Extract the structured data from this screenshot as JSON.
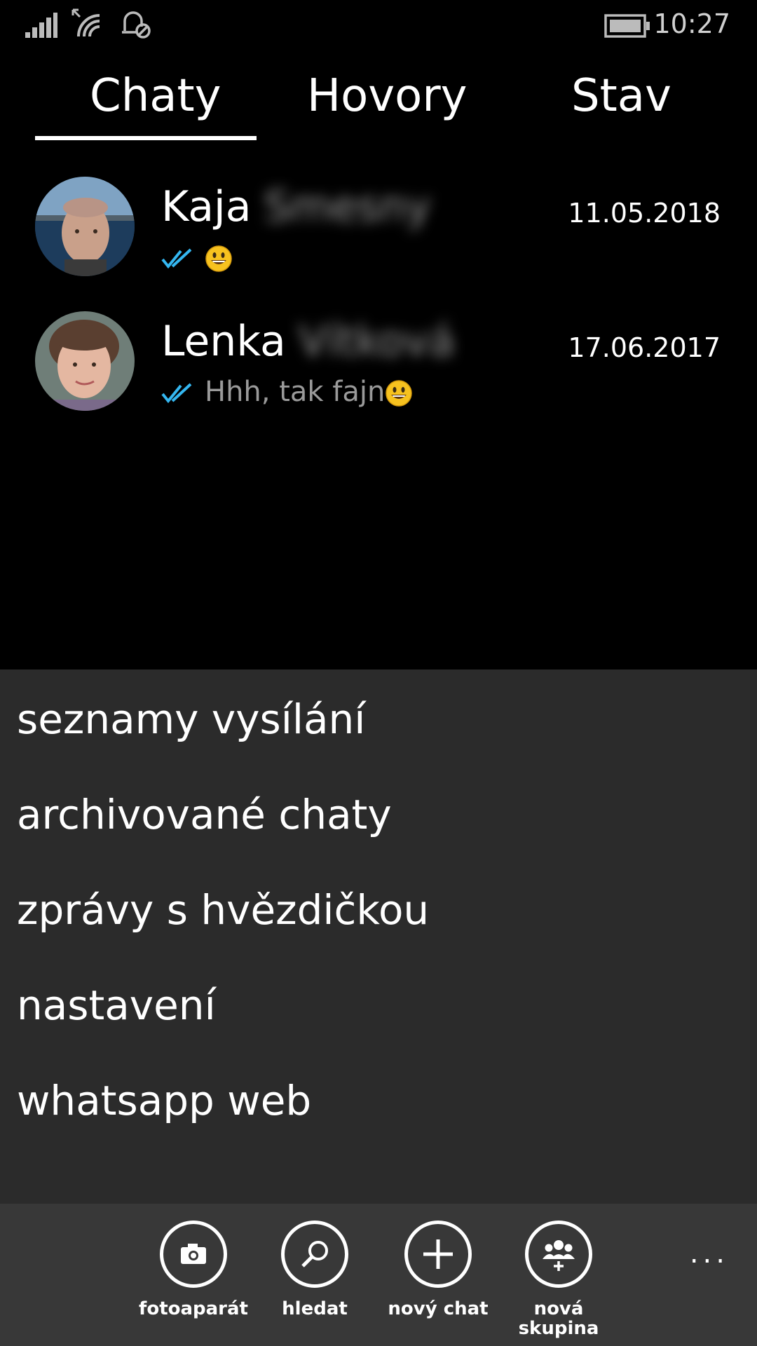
{
  "status_bar": {
    "icons": [
      "signal-icon",
      "wifi-icon",
      "quiet-hours-icon",
      "battery-icon"
    ],
    "time": "10:27"
  },
  "tabs": [
    {
      "label": "Chaty",
      "selected": true
    },
    {
      "label": "Hovory",
      "selected": false
    },
    {
      "label": "Stav",
      "selected": false
    }
  ],
  "chats": [
    {
      "first_name": "Kaja",
      "last_name_blurred": "Smesny",
      "date": "11.05.2018",
      "preview": "",
      "emoji": "smiley",
      "ticks": "read-double-check"
    },
    {
      "first_name": "Lenka",
      "last_name_blurred": "Vítková",
      "date": "17.06.2017",
      "preview": "Hhh, tak fajn",
      "emoji": "smiley",
      "ticks": "read-double-check"
    }
  ],
  "menu": {
    "items": [
      "seznamy vysílání",
      "archivované chaty",
      "zprávy s hvězdičkou",
      "nastavení",
      "whatsapp web"
    ]
  },
  "app_bar": {
    "buttons": [
      {
        "label": "fotoaparát",
        "icon": "camera-icon"
      },
      {
        "label": "hledat",
        "icon": "search-icon"
      },
      {
        "label": "nový chat",
        "icon": "plus-icon"
      },
      {
        "label": "nová skupina",
        "icon": "group-add-icon"
      }
    ],
    "more": "..."
  },
  "colors": {
    "background": "#000000",
    "menu_panel": "#2b2b2b",
    "app_bar": "#383838",
    "tick_blue": "#34b7f1",
    "muted_text": "#9a9a9a"
  }
}
